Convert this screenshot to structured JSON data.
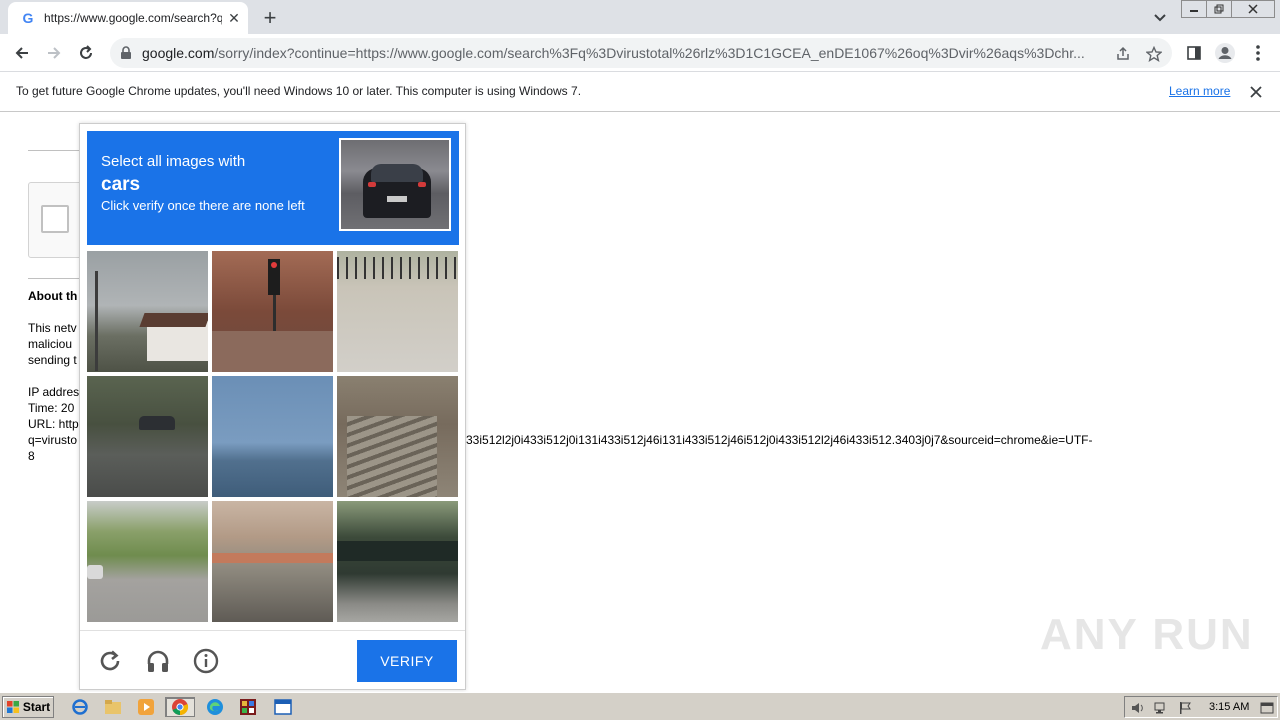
{
  "browser": {
    "tab_title": "https://www.google.com/search?q=",
    "tab_favicon": "G",
    "url_domain": "google.com",
    "url_path": "/sorry/index?continue=https://www.google.com/search%3Fq%3Dvirustotal%26rlz%3D1C1GCEA_enDE1067%26oq%3Dvir%26aqs%3Dchr...",
    "infobar_message": "To get future Google Chrome updates, you'll need Windows 10 or later. This computer is using Windows 7.",
    "infobar_link": "Learn more"
  },
  "page": {
    "about_heading": "About th",
    "para1": [
      "This netv",
      "maliciou",
      "sending t"
    ],
    "ip_label": "IP addres",
    "time_label": "Time: 20",
    "url_label": "URL: http",
    "url_q": "q=virusto",
    "url_tail": "33i512l2j0i433i512j0i131i433i512j46i131i433i512j46i512j0i433i512l2j46i433i512.3403j0j7&sourceid=chrome&ie=UTF-",
    "url_tail_end": "8"
  },
  "captcha": {
    "line1": "Select all images with",
    "target": "cars",
    "line3": "Click verify once there are none left",
    "verify_label": "VERIFY",
    "accent": "#1a73e8"
  },
  "watermark": "ANY RUN",
  "taskbar": {
    "start_label": "Start",
    "time": "3:15 AM"
  }
}
